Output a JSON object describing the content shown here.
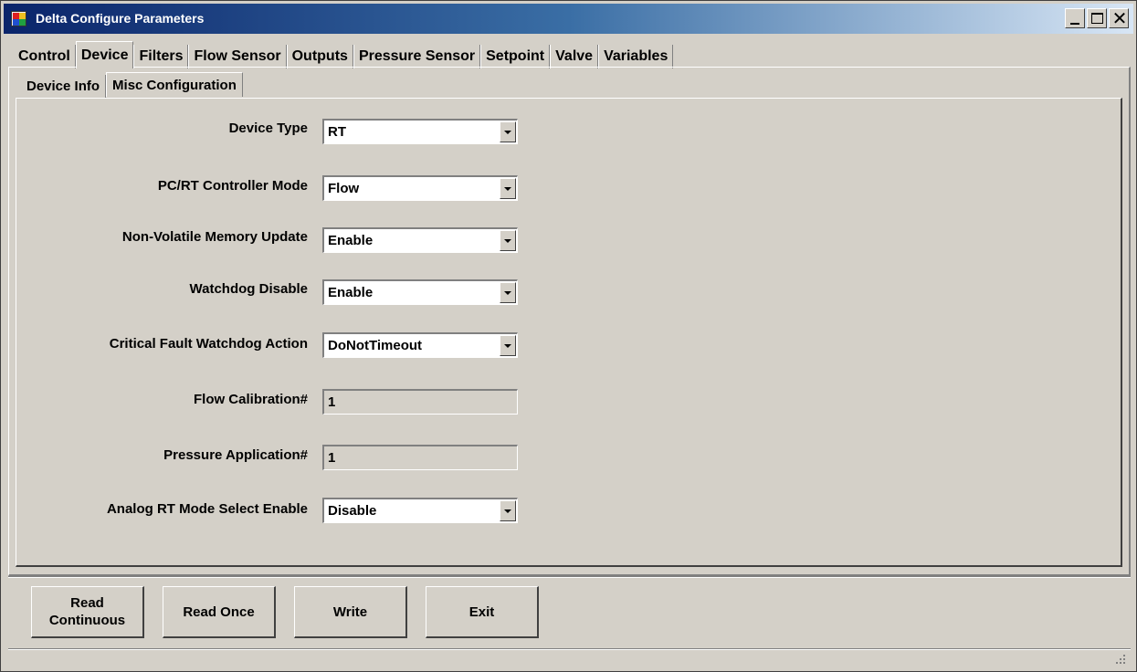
{
  "window": {
    "title": "Delta Configure Parameters"
  },
  "main_tabs": [
    "Control",
    "Device",
    "Filters",
    "Flow Sensor",
    "Outputs",
    "Pressure Sensor",
    "Setpoint",
    "Valve",
    "Variables"
  ],
  "active_main_tab": "Device",
  "sub_tabs": [
    "Device Info",
    "Misc Configuration"
  ],
  "active_sub_tab": "Misc Configuration",
  "fields": [
    {
      "label": "Device Type",
      "value": "RT",
      "kind": "dropdown"
    },
    {
      "label": "PC/RT Controller Mode",
      "value": "Flow",
      "kind": "dropdown"
    },
    {
      "label": "Non-Volatile Memory Update",
      "value": "Enable",
      "kind": "dropdown"
    },
    {
      "label": "Watchdog Disable",
      "value": "Enable",
      "kind": "dropdown"
    },
    {
      "label": "Critical Fault Watchdog Action",
      "value": "DoNotTimeout",
      "kind": "dropdown"
    },
    {
      "label": "Flow Calibration#",
      "value": "1",
      "kind": "readonly"
    },
    {
      "label": "Pressure Application#",
      "value": "1",
      "kind": "readonly"
    },
    {
      "label": "Analog RT Mode Select Enable",
      "value": "Disable",
      "kind": "dropdown"
    }
  ],
  "buttons": {
    "read_continuous_line1": "Read",
    "read_continuous_line2": "Continuous",
    "read_once": "Read Once",
    "write": "Write",
    "exit": "Exit"
  },
  "colors": {
    "face": "#d4d0c8",
    "title_start": "#0a246a",
    "title_end": "#d8e6f5"
  }
}
